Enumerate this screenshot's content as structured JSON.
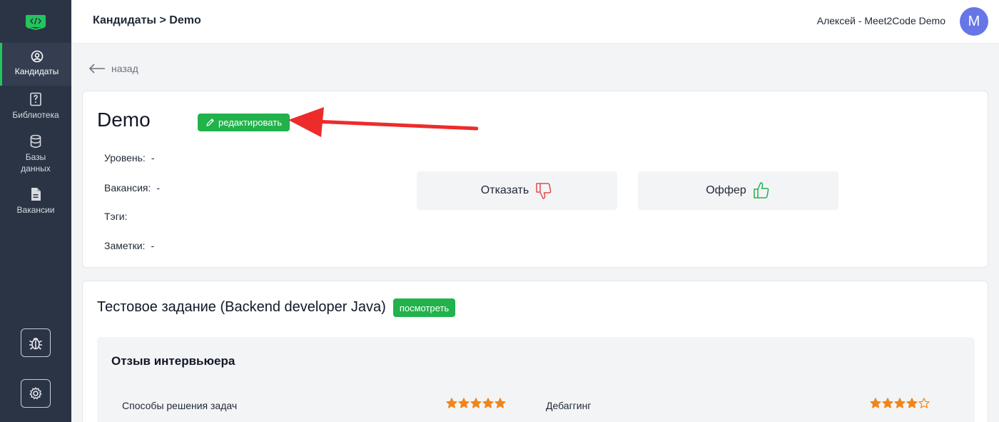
{
  "sidebar": {
    "logo_icon": "code-book-icon",
    "items": [
      {
        "label": "Кандидаты",
        "icon": "user-circle-icon",
        "active": true
      },
      {
        "label": "Библиотека",
        "icon": "question-book-icon",
        "active": false
      },
      {
        "label": "Базы данных",
        "icon": "database-icon",
        "active": false
      },
      {
        "label": "Вакансии",
        "icon": "document-icon",
        "active": false
      }
    ],
    "bottom_buttons": [
      {
        "icon": "bug-icon"
      },
      {
        "icon": "gear-icon"
      }
    ]
  },
  "header": {
    "breadcrumb": "Кандидаты > Demo",
    "user_name": "Алексей - Meet2Code Demo",
    "avatar_letter": "M"
  },
  "back_label": "назад",
  "candidate": {
    "name": "Demo",
    "edit_label": "редактировать",
    "fields": {
      "level_label": "Уровень:",
      "level_value": "-",
      "vacancy_label": "Вакансия:",
      "vacancy_value": "-",
      "tags_label": "Тэги:",
      "tags_value": "",
      "notes_label": "Заметки:",
      "notes_value": "-"
    },
    "reject_label": "Отказать",
    "offer_label": "Оффер"
  },
  "task": {
    "title": "Тестовое задание (Backend developer Java)",
    "view_label": "посмотреть",
    "review": {
      "title": "Отзыв интервьюера",
      "criteria": [
        {
          "label": "Способы решения задач",
          "rating": 5,
          "max": 5
        },
        {
          "label": "Дебаггинг",
          "rating": 4,
          "max": 5
        }
      ]
    }
  },
  "colors": {
    "sidebar_bg": "#2b3445",
    "accent_green": "#22b24c",
    "avatar_bg": "#6676e6",
    "star_orange": "#f0861a",
    "reject_red": "#e5484d",
    "annotation_arrow": "#ee2b2b"
  }
}
